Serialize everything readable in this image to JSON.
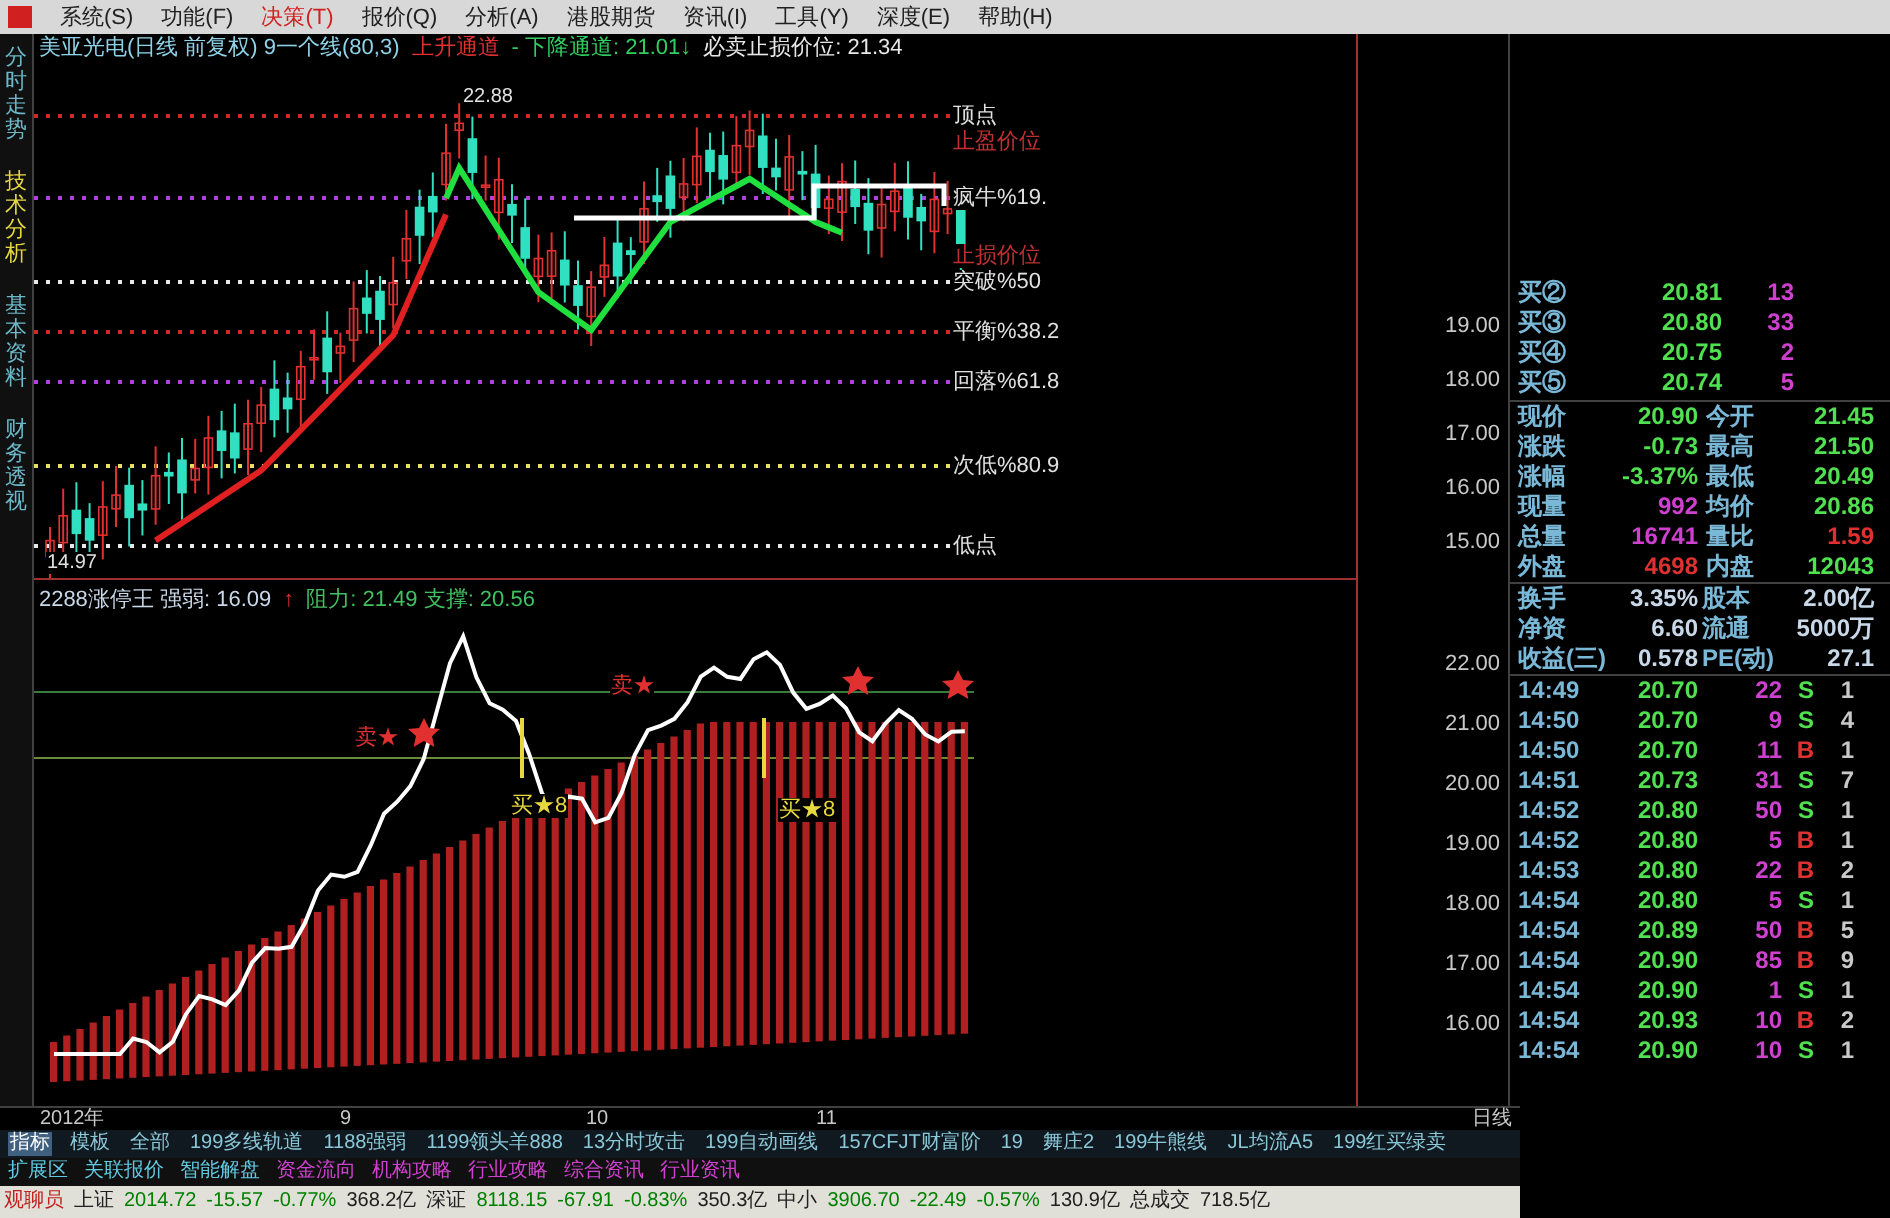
{
  "menu": [
    {
      "label": "系统(S)",
      "selected": false
    },
    {
      "label": "功能(F)",
      "selected": false
    },
    {
      "label": "决策(T)",
      "selected": true
    },
    {
      "label": "报价(Q)",
      "selected": false
    },
    {
      "label": "分析(A)",
      "selected": false
    },
    {
      "label": "港股期货",
      "selected": false
    },
    {
      "label": "资讯(I)",
      "selected": false
    },
    {
      "label": "工具(Y)",
      "selected": false
    },
    {
      "label": "深度(E)",
      "selected": false
    },
    {
      "label": "帮助(H)",
      "selected": false
    }
  ],
  "side_tabs": [
    {
      "label": "分时走势",
      "selected": false
    },
    {
      "label": "技术分析",
      "selected": true
    },
    {
      "label": "基本资料",
      "selected": false
    },
    {
      "label": "财务透视",
      "selected": false
    }
  ],
  "price_chart": {
    "legend": [
      {
        "text": "美亚光电(日线 前复权) 9一个线(80,3)",
        "color": "#8fd3e8"
      },
      {
        "text": "上升通道",
        "color": "#e03030"
      },
      {
        "text": "- 下降通道: 21.01↓",
        "color": "#30d060"
      },
      {
        "text": "必卖止损价位: 21.34",
        "color": "#e8e8e8"
      }
    ],
    "levels": [
      {
        "kind": "level",
        "label": "顶点",
        "color": "#d02828"
      },
      {
        "kind": "stop",
        "label": "止盈价位",
        "color": "#c03030"
      },
      {
        "kind": "level",
        "label": "疯牛%19.",
        "color": "#b040e0"
      },
      {
        "kind": "stop",
        "label": "止损价位",
        "color": "#c03030"
      },
      {
        "kind": "level",
        "label": "突破%50",
        "color": "#e8e8e8"
      },
      {
        "kind": "level",
        "label": "平衡%38.2",
        "color": "#d02828"
      },
      {
        "kind": "level",
        "label": "回落%61.8",
        "color": "#b040e0"
      },
      {
        "kind": "level",
        "label": "次低%80.9",
        "color": "#e8e060"
      },
      {
        "kind": "level",
        "label": "低点",
        "color": "#e8e8e8"
      }
    ],
    "annotations": [
      "22.88",
      "14.97"
    ],
    "axis": [
      "19.00",
      "18.00",
      "17.00",
      "16.00",
      "15.00"
    ]
  },
  "indicator": {
    "name": "2288涨停王 强弱: 16.09",
    "arrow": "↑",
    "values": "阻力: 21.49 支撑: 20.56",
    "signals": [
      {
        "kind": "sell",
        "text": "卖★"
      },
      {
        "kind": "sell",
        "text": "卖★"
      },
      {
        "kind": "buy",
        "text": "买★8"
      },
      {
        "kind": "buy",
        "text": "买★8"
      }
    ],
    "axis": [
      "22.00",
      "21.00",
      "20.00",
      "19.00",
      "18.00",
      "17.00",
      "16.00"
    ]
  },
  "time_axis": [
    "2012年",
    "9",
    "10",
    "11"
  ],
  "period": "日线",
  "quote": {
    "bids": [
      {
        "label": "买②",
        "price": "20.81",
        "volume": "13"
      },
      {
        "label": "买③",
        "price": "20.80",
        "volume": "33"
      },
      {
        "label": "买④",
        "price": "20.75",
        "volume": "2"
      },
      {
        "label": "买⑤",
        "price": "20.74",
        "volume": "5"
      }
    ],
    "stats": [
      {
        "label": "现价",
        "value": "20.90",
        "color": "#50e050"
      },
      {
        "label": "今开",
        "value": "21.45",
        "color": "#50e050"
      },
      {
        "label": "涨跌",
        "value": "-0.73",
        "color": "#50e050"
      },
      {
        "label": "最高",
        "value": "21.50",
        "color": "#50e050"
      },
      {
        "label": "涨幅",
        "value": "-3.37%",
        "color": "#50e050"
      },
      {
        "label": "最低",
        "value": "20.49",
        "color": "#50e050"
      },
      {
        "label": "现量",
        "value": "992",
        "color": "#d040d0"
      },
      {
        "label": "均价",
        "value": "20.86",
        "color": "#50e050"
      },
      {
        "label": "总量",
        "value": "16741",
        "color": "#d040d0"
      },
      {
        "label": "量比",
        "value": "1.59",
        "color": "#e03030"
      },
      {
        "label": "外盘",
        "value": "4698",
        "color": "#e03030"
      },
      {
        "label": "内盘",
        "value": "12043",
        "color": "#50e050"
      }
    ],
    "fundamentals": [
      {
        "label": "换手",
        "value": "3.35%",
        "label2": "股本",
        "value2": "2.00亿"
      },
      {
        "label": "净资",
        "value": "6.60",
        "label2": "流通",
        "value2": "5000万"
      },
      {
        "label": "收益(三)",
        "value": "0.578",
        "label2": "PE(动)",
        "value2": "27.1"
      }
    ],
    "ticks": [
      {
        "time": "14:49",
        "price": "20.70",
        "volume": "22",
        "side": "S",
        "kind": "sell",
        "column_5": "1"
      },
      {
        "time": "14:50",
        "price": "20.70",
        "volume": "9",
        "side": "S",
        "kind": "sell",
        "column_5": "4"
      },
      {
        "time": "14:50",
        "price": "20.70",
        "volume": "11",
        "side": "B",
        "kind": "buy",
        "column_5": "1"
      },
      {
        "time": "14:51",
        "price": "20.73",
        "volume": "31",
        "side": "S",
        "kind": "sell",
        "column_5": "7"
      },
      {
        "time": "14:52",
        "price": "20.80",
        "volume": "50",
        "side": "S",
        "kind": "sell",
        "column_5": "1"
      },
      {
        "time": "14:52",
        "price": "20.80",
        "volume": "5",
        "side": "B",
        "kind": "buy",
        "column_5": "1"
      },
      {
        "time": "14:53",
        "price": "20.80",
        "volume": "22",
        "side": "B",
        "kind": "buy",
        "column_5": "2"
      },
      {
        "time": "14:54",
        "price": "20.80",
        "volume": "5",
        "side": "S",
        "kind": "sell",
        "column_5": "1"
      },
      {
        "time": "14:54",
        "price": "20.89",
        "volume": "50",
        "side": "B",
        "kind": "buy",
        "column_5": "5"
      },
      {
        "time": "14:54",
        "price": "20.90",
        "volume": "85",
        "side": "B",
        "kind": "buy",
        "column_5": "9"
      },
      {
        "time": "14:54",
        "price": "20.90",
        "volume": "1",
        "side": "S",
        "kind": "sell",
        "column_5": "1"
      },
      {
        "time": "14:54",
        "price": "20.93",
        "volume": "10",
        "side": "B",
        "kind": "buy",
        "column_5": "2"
      },
      {
        "time": "14:54",
        "price": "20.90",
        "volume": "10",
        "side": "S",
        "kind": "sell",
        "column_5": "1"
      }
    ]
  },
  "formula_tabs": [
    {
      "label": "指标",
      "selected": true
    },
    {
      "label": "模板",
      "selected": false
    },
    {
      "label": "全部",
      "selected": false
    },
    {
      "label": "199多线轨道",
      "selected": false
    },
    {
      "label": "1188强弱",
      "selected": false
    },
    {
      "label": "1199领头羊888",
      "selected": false
    },
    {
      "label": "13分时攻击",
      "selected": false
    },
    {
      "label": "199自动画线",
      "selected": false
    },
    {
      "label": "157CFJT财富阶",
      "selected": false
    },
    {
      "label": "19",
      "selected": false
    },
    {
      "label": "舞庄2",
      "selected": false
    },
    {
      "label": "199牛熊线",
      "selected": false
    },
    {
      "label": "JL均流A5",
      "selected": false
    },
    {
      "label": "199红买绿卖",
      "selected": false
    }
  ],
  "extension_tabs": [
    {
      "label": "扩展区",
      "color": "#60c8e0"
    },
    {
      "label": "关联报价",
      "color": "#60c8e0"
    },
    {
      "label": "智能解盘",
      "color": "#60c8e0"
    },
    {
      "label": "资金流向",
      "color": "#d040d0"
    },
    {
      "label": "机构攻略",
      "color": "#d040d0"
    },
    {
      "label": "行业攻略",
      "color": "#d040d0"
    },
    {
      "label": "综合资讯",
      "color": "#d040d0"
    },
    {
      "label": "行业资讯",
      "color": "#d040d0"
    }
  ],
  "status_bar": {
    "label": "观聊员",
    "indices": [
      {
        "name": "上证",
        "value": "2014.72",
        "change": "-15.57",
        "pct": "-0.77%",
        "amount": "368.2亿"
      },
      {
        "name": "深证",
        "value": "8118.15",
        "change": "-67.91",
        "pct": "-0.83%",
        "amount": "350.3亿"
      },
      {
        "name": "中小",
        "value": "3906.70",
        "change": "-22.49",
        "pct": "-0.57%",
        "amount": "130.9亿"
      }
    ],
    "total_label": "总成交",
    "total": "718.5亿"
  }
}
